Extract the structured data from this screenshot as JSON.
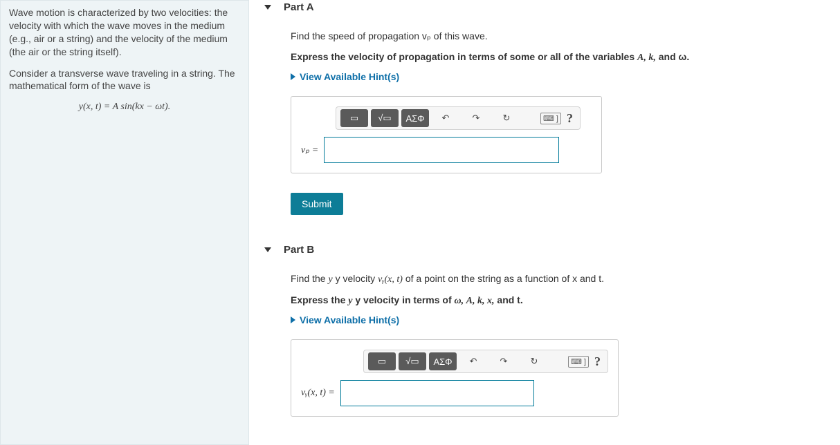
{
  "left_panel": {
    "para1": "Wave motion is characterized by two velocities: the velocity with which the wave moves in the medium (e.g., air or a string) and the velocity of the medium (the air or the string itself).",
    "para2": "Consider a transverse wave traveling in a string. The mathematical form of the wave is",
    "equation": "y(x, t) = A sin(kx − ωt)."
  },
  "parts": [
    {
      "title": "Part A",
      "question": "Find the speed of propagation vₚ of this wave.",
      "express_prefix": "Express the velocity of propagation in terms of some or all of the variables ",
      "express_vars": "A, k,",
      "express_suffix": " and ω.",
      "hints_label": "View Available Hint(s)",
      "answer_label": "vₚ =",
      "submit_label": "Submit"
    },
    {
      "title": "Part B",
      "question_prefix": "Find the ",
      "question_yvel": "y velocity ",
      "question_func": "vᵧ(x, t)",
      "question_suffix": " of a point on the string as a function of x and t.",
      "express_prefix": "Express the ",
      "express_yvel": "y velocity in terms of ",
      "express_vars": "ω, A, k, x,",
      "express_suffix": " and t.",
      "hints_label": "View Available Hint(s)",
      "answer_label": "vᵧ(x, t) ="
    }
  ],
  "toolbar": {
    "template_icon": "▭",
    "sqrt_icon": "√▭",
    "greek_label": "ΑΣΦ",
    "undo_icon": "↶",
    "redo_icon": "↷",
    "reset_icon": "↻",
    "keyboard_icon": "⌨ ]",
    "help_icon": "?"
  }
}
